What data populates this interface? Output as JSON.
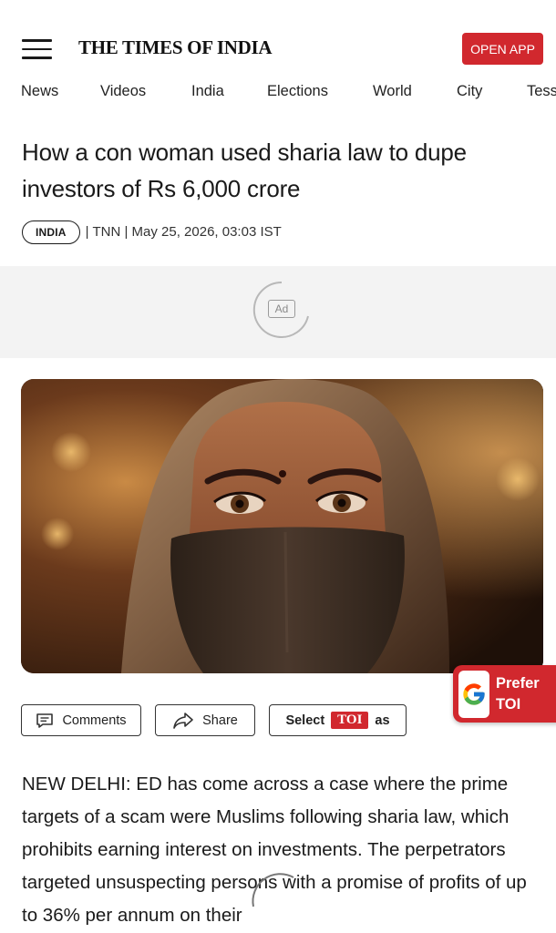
{
  "header": {
    "logo": "THE TIMES OF INDIA",
    "open_app_label": "OPEN APP"
  },
  "nav": {
    "items": [
      "News",
      "Videos",
      "India",
      "Elections",
      "World",
      "City",
      "Tess"
    ]
  },
  "article": {
    "headline": "How a con woman used sharia law to dupe investors of Rs 6,000 crore",
    "section": "INDIA",
    "byline": "| TNN | May 25, 2026, 03:03 IST",
    "body": "NEW DELHI: ED has come across a case where the prime targets of a scam were Muslims following sharia law, which prohibits earning interest on investments. The perpetrators targeted unsuspecting persons with a promise of profits of up to 36% per annum on their"
  },
  "ad": {
    "label": "Ad"
  },
  "actions": {
    "comments_label": "Comments",
    "share_label": "Share",
    "select_prefix": "Select",
    "select_badge": "TOI",
    "select_suffix": "as"
  },
  "prefer_widget": {
    "line1": "Prefer",
    "line2": "TOI"
  },
  "colors": {
    "brand_red": "#d1282e",
    "text": "#1a1a1a",
    "ad_bg": "#f3f3f3"
  },
  "icons": [
    "hamburger-menu-icon",
    "comment-icon",
    "share-icon",
    "google-g-icon",
    "loading-spinner-icon"
  ]
}
